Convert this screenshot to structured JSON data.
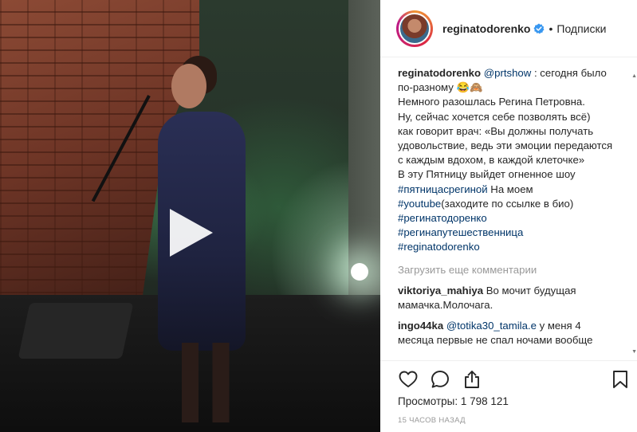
{
  "post": {
    "author": "reginatodorenko",
    "follow_label": "Подписки",
    "dot": "•"
  },
  "caption": {
    "username": "reginatodorenko",
    "mention": "@prtshow",
    "line1_rest": " : сегодня было по-разному 😂🙈",
    "line2": "Немного разошлась Регина Петровна.",
    "line3": "Ну, сейчас хочется себе позволять всё)",
    "line4": "как говорит врач: «Вы должны получать удовольствие, ведь эти эмоции передаются с каждым вдохом, в каждой клеточке»",
    "line5": "В эту Пятницу выйдет огненное шоу",
    "hashtag1": "#пятницасрегиной",
    "text_after_hashtag1": " На моем",
    "hashtag2": "#youtube",
    "text_after_hashtag2": "(заходите по ссылке в био)",
    "hashtag3": "#регинатодоренко",
    "hashtag4": "#регинапутешественница",
    "hashtag5": "#reginatodorenko"
  },
  "load_more_label": "Загрузить еще комментарии",
  "comments": [
    {
      "username": "viktoriya_mahiya",
      "text": " Во мочит будущая мамачка.Молочага."
    },
    {
      "username": "ingo44ka",
      "mention": "@totika30_tamila.e",
      "text": " у меня 4 месяца первые не спал ночами вообще"
    }
  ],
  "stats": {
    "views_label": "Просмотры:",
    "views_value": "1 798 121",
    "time_ago": "15 ЧАСОВ НАЗАД"
  },
  "icons": {
    "play": "play-icon",
    "verified": "verified-badge-icon",
    "like": "heart-icon",
    "comment": "comment-bubble-icon",
    "share": "share-icon",
    "save": "bookmark-icon"
  },
  "colors": {
    "link": "#003569",
    "muted": "#999999",
    "text": "#262626",
    "verified": "#3897f0"
  }
}
